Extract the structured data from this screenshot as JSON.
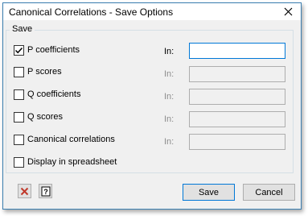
{
  "window": {
    "title": "Canonical Correlations - Save Options",
    "close_icon": "close-icon"
  },
  "group": {
    "label": "Save"
  },
  "options": [
    {
      "label": "P coefficients",
      "checked": true,
      "in_label": "In:",
      "in_value": "",
      "in_enabled": true
    },
    {
      "label": "P scores",
      "checked": false,
      "in_label": "In:",
      "in_value": "",
      "in_enabled": false
    },
    {
      "label": "Q coefficients",
      "checked": false,
      "in_label": "In:",
      "in_value": "",
      "in_enabled": false
    },
    {
      "label": "Q scores",
      "checked": false,
      "in_label": "In:",
      "in_value": "",
      "in_enabled": false
    },
    {
      "label": "Canonical correlations",
      "checked": false,
      "in_label": "In:",
      "in_value": "",
      "in_enabled": false
    },
    {
      "label": "Display in spreadsheet",
      "checked": false
    }
  ],
  "buttons": {
    "clear_icon": "clear-x-icon",
    "help_icon": "help-icon",
    "save_label": "Save",
    "cancel_label": "Cancel"
  },
  "colors": {
    "accent": "#0078d7",
    "clear_x": "#c0392b",
    "window_border": "#3c7fb1"
  }
}
